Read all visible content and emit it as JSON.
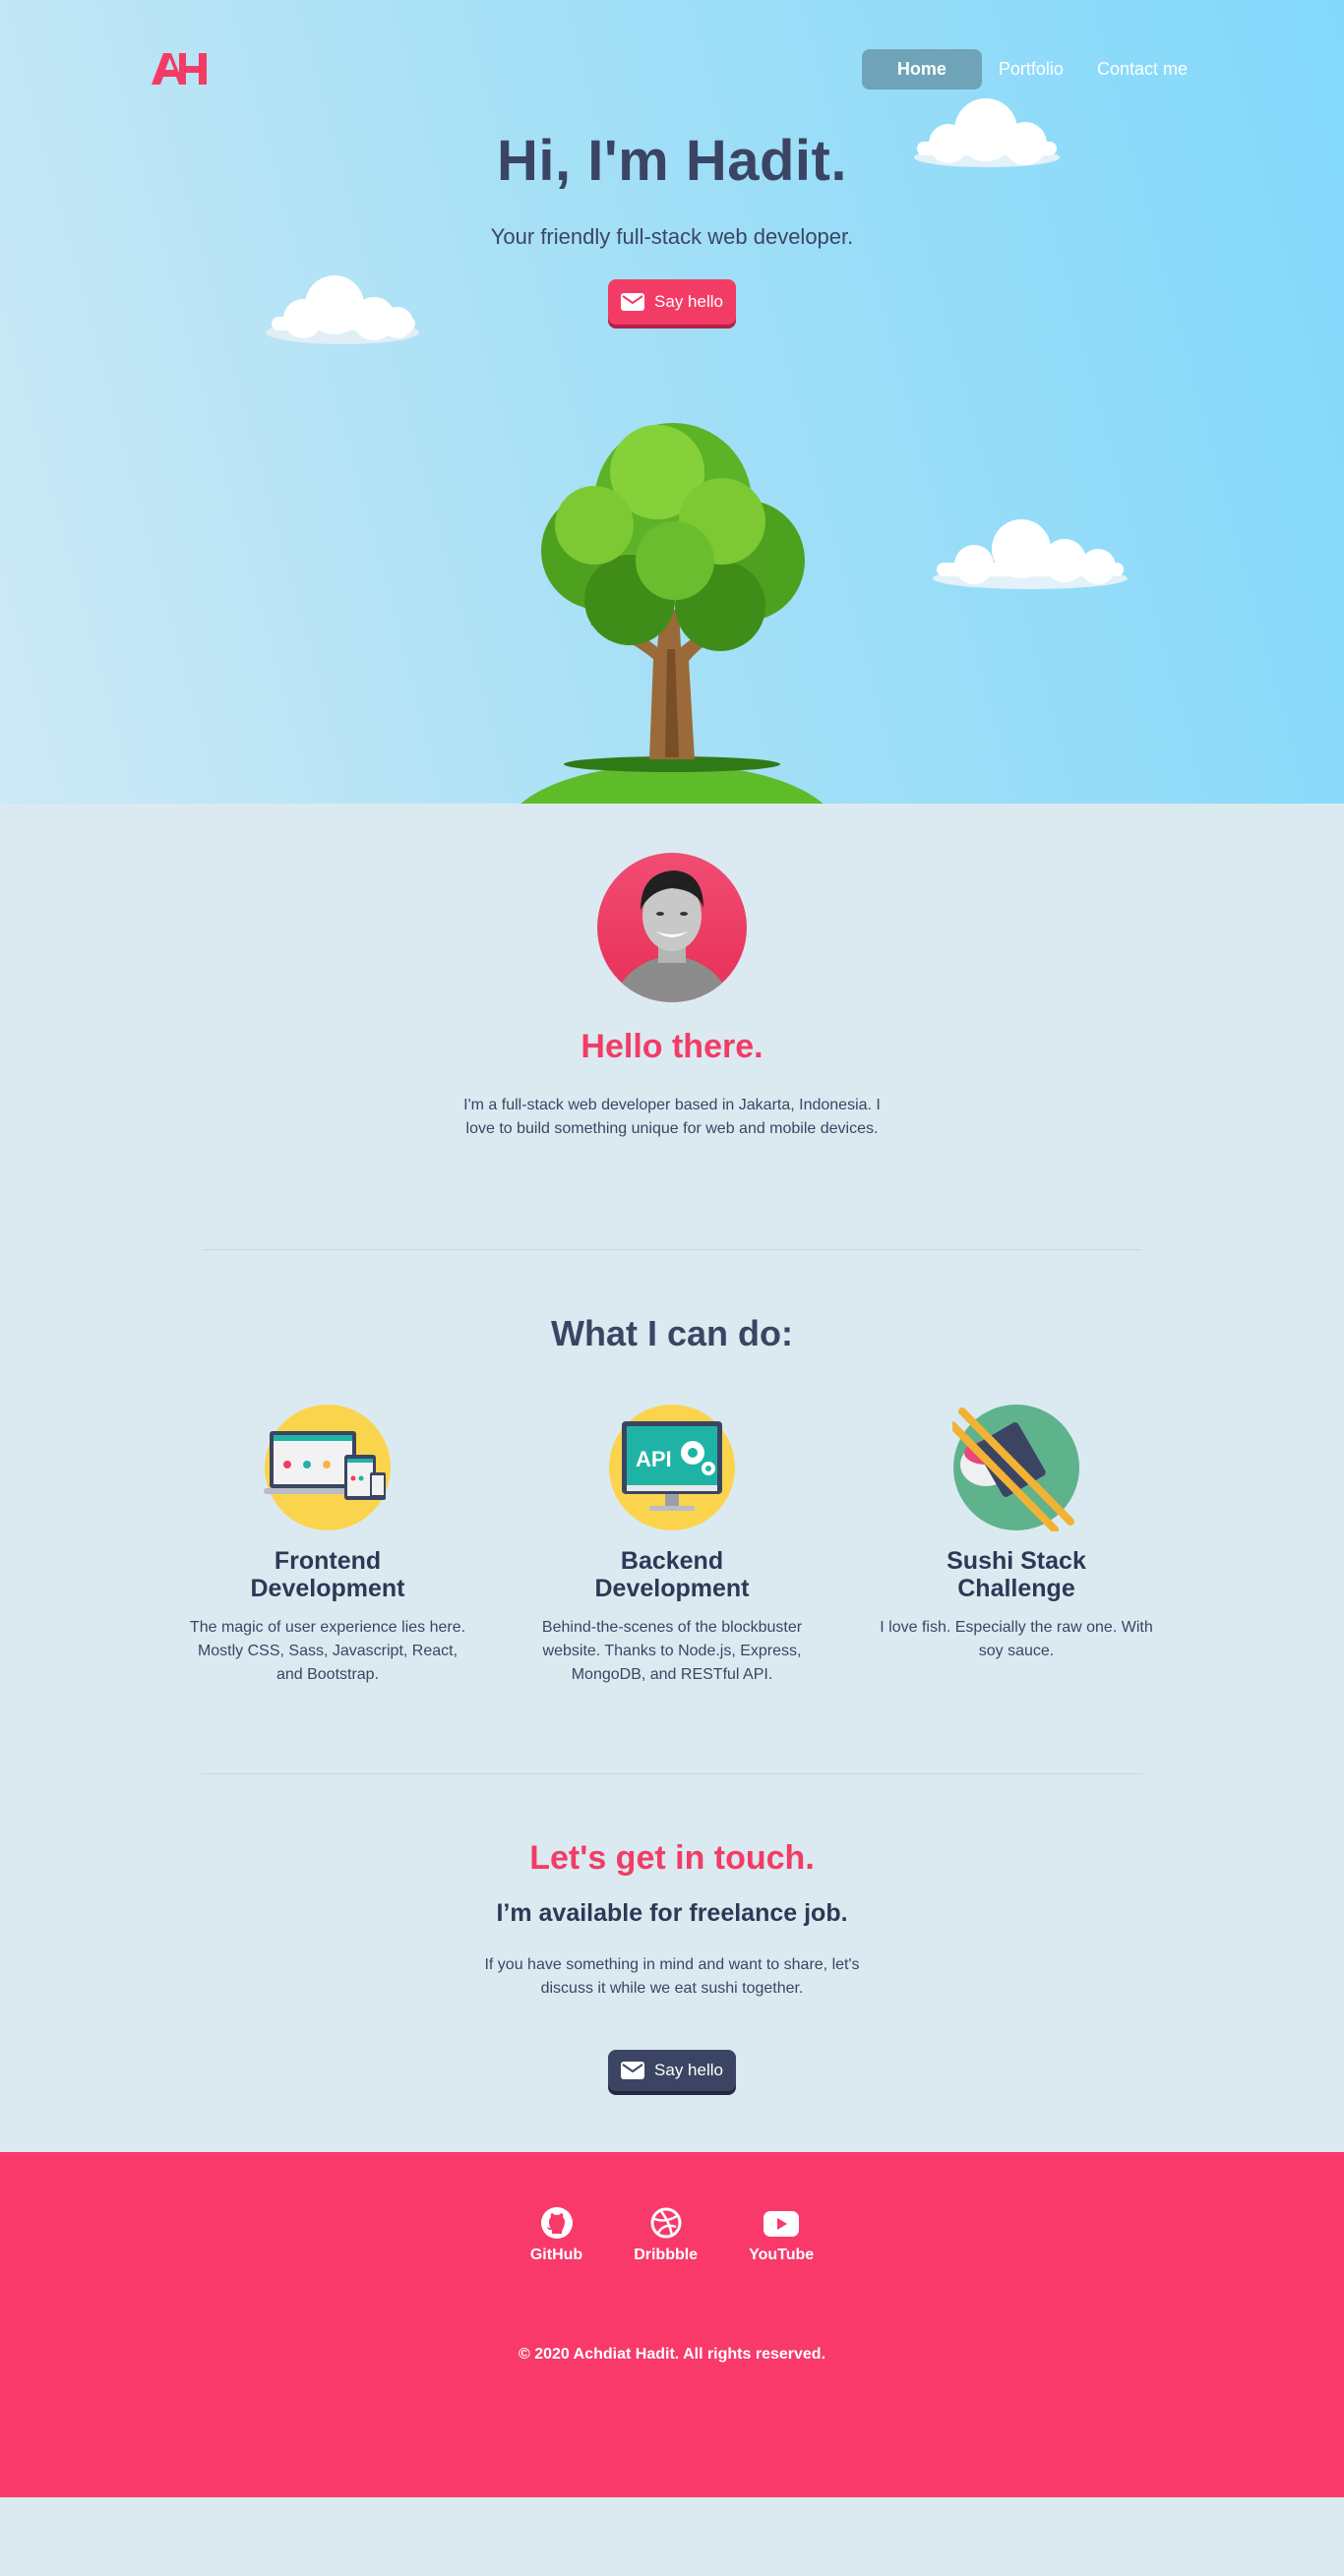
{
  "brand": {
    "logo_text": "AH",
    "accent": "#f23c66",
    "dark": "#3b4563"
  },
  "nav": {
    "items": [
      {
        "label": "Home",
        "active": true
      },
      {
        "label": "Portfolio",
        "active": false
      },
      {
        "label": "Contact me",
        "active": false
      }
    ]
  },
  "hero": {
    "title": "Hi, I'm Hadit.",
    "subtitle": "Your friendly full-stack web developer.",
    "button_label": "Say hello",
    "button_icon": "mail-icon"
  },
  "about": {
    "heading": "Hello there.",
    "text": "I'm a full-stack web developer based in Jakarta, Indonesia. I love to build something unique for web and mobile devices."
  },
  "skills": {
    "heading": "What I can do:",
    "items": [
      {
        "title": "Frontend Development",
        "desc": "The magic of user experience lies here. Mostly CSS, Sass, Javascript, React, and Bootstrap.",
        "icon": "devices-icon"
      },
      {
        "title": "Backend Development",
        "desc": "Behind-the-scenes of the blockbuster website. Thanks to Node.js, Express, MongoDB, and RESTful API.",
        "icon": "api-monitor-icon",
        "icon_text": "API"
      },
      {
        "title": "Sushi Stack Challenge",
        "desc": "I love fish. Especially the raw one. With soy sauce.",
        "icon": "sushi-icon"
      }
    ]
  },
  "contact": {
    "heading": "Let's get in touch.",
    "subheading": "I’m available for freelance job.",
    "text": "If you have something in mind and want to share, let's discuss it while we eat sushi together.",
    "button_label": "Say hello",
    "button_icon": "mail-icon"
  },
  "footer": {
    "socials": [
      {
        "label": "GitHub",
        "icon": "github-icon"
      },
      {
        "label": "Dribbble",
        "icon": "dribbble-icon"
      },
      {
        "label": "YouTube",
        "icon": "youtube-icon"
      }
    ],
    "copyright": "© 2020 Achdiat Hadit. All rights reserved."
  }
}
